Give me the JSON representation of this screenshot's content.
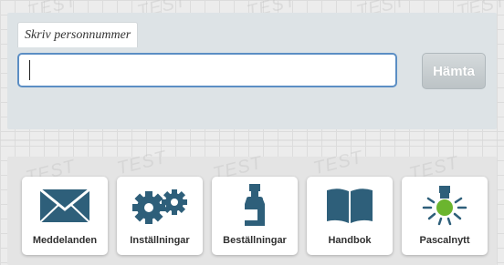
{
  "search": {
    "label": "Skriv personnummer",
    "value": "",
    "placeholder": "",
    "button_label": "Hämta"
  },
  "watermark_text": "TEST",
  "tiles": [
    {
      "label": "Meddelanden",
      "icon": "envelope-icon"
    },
    {
      "label": "Inställningar",
      "icon": "gears-icon"
    },
    {
      "label": "Beställningar",
      "icon": "medicine-bottle-icon"
    },
    {
      "label": "Handbok",
      "icon": "book-icon"
    },
    {
      "label": "Pascalnytt",
      "icon": "lightbulb-icon"
    }
  ],
  "colors": {
    "icon_blue": "#2e5f7a",
    "input_border": "#5b8ec4",
    "bulb_green": "#6bb52e"
  }
}
